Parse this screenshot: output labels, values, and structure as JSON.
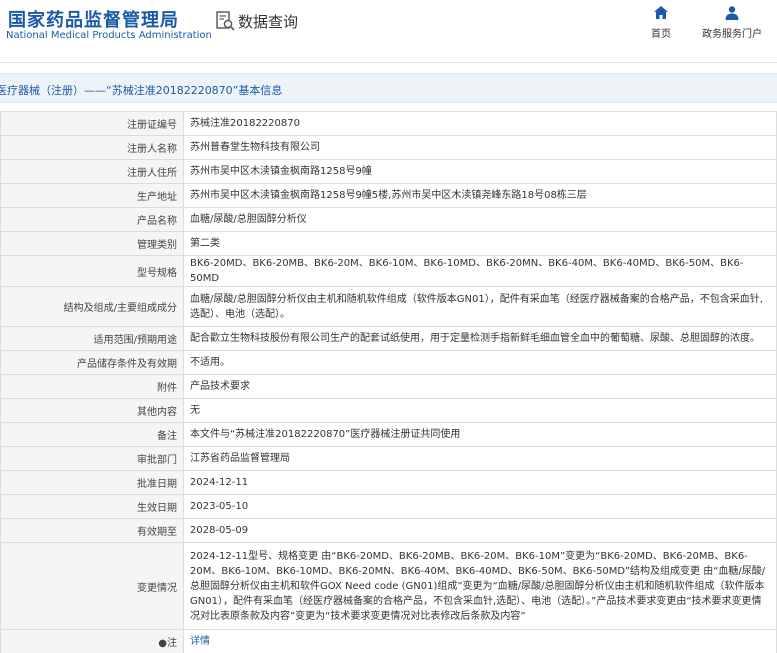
{
  "header": {
    "logo_cn": "国家药品监督管理局",
    "logo_en": "National Medical Products Administration",
    "query_label": "数据查询",
    "nav": {
      "home": "首页",
      "portal": "政务服务门户"
    }
  },
  "page": {
    "breadcrumb": "医疗器械（注册）——“苏械注准20182220870”基本信息"
  },
  "colors": {
    "brand": "#1c5aa8",
    "label_bg": "#f5f5f5",
    "title_bg": "#eef3f8",
    "border": "#dcdcdc"
  },
  "rows": [
    {
      "label": "注册证编号",
      "value": "苏械注准20182220870"
    },
    {
      "label": "注册人名称",
      "value": "苏州普春堂生物科技有限公司"
    },
    {
      "label": "注册人住所",
      "value": "苏州市吴中区木渎镇金枫南路1258号9幢"
    },
    {
      "label": "生产地址",
      "value": "苏州市吴中区木渎镇金枫南路1258号9幢5楼,苏州市吴中区木渎镇尧峰东路18号08栋三层"
    },
    {
      "label": "产品名称",
      "value": "血糖/尿酸/总胆固醇分析仪"
    },
    {
      "label": "管理类别",
      "value": "第二类"
    },
    {
      "label": "型号规格",
      "value": "BK6-20MD、BK6-20MB、BK6-20M、BK6-10M、BK6-10MD、BK6-20MN、BK6-40M、BK6-40MD、BK6-50M、BK6-50MD"
    },
    {
      "label": "结构及组成/主要组成成分",
      "value": "血糖/尿酸/总胆固醇分析仪由主机和随机软件组成（软件版本GN01），配件有采血笔（经医疗器械备案的合格产品，不包含采血针,选配）、电池（选配）。"
    },
    {
      "label": "适用范围/预期用途",
      "value": "配合歡立生物科技股份有限公司生产的配套试纸使用，用于定量检测手指新鲜毛细血管全血中的葡萄糖、尿酸、总胆固醇的浓度。"
    },
    {
      "label": "产品储存条件及有效期",
      "value": "不适用。"
    },
    {
      "label": "附件",
      "value": "产品技术要求"
    },
    {
      "label": "其他内容",
      "value": "无"
    },
    {
      "label": "备注",
      "value": "本文件与“苏械注准20182220870”医疗器械注册证共同使用"
    },
    {
      "label": "审批部门",
      "value": "江苏省药品监督管理局"
    },
    {
      "label": "批准日期",
      "value": "2024-12-11"
    },
    {
      "label": "生效日期",
      "value": "2023-05-10"
    },
    {
      "label": "有效期至",
      "value": "2028-05-09"
    },
    {
      "label": "变更情况",
      "value": "2024-12-11型号、规格变更 由“BK6-20MD、BK6-20MB、BK6-20M、BK6-10M”变更为“BK6-20MD、BK6-20MB、BK6-20M、BK6-10M、BK6-10MD、BK6-20MN、BK6-40M、BK6-40MD、BK6-50M、BK6-50MD”结构及组成变更 由“血糖/尿酸/总胆固醇分析仪由主机和软件GOX Need code (GN01)组成”变更为“血糖/尿酸/总胆固醇分析仪由主机和随机软件组成（软件版本GN01），配件有采血笔（经医疗器械备案的合格产品，不包含采血针,选配）、电池（选配）。”产品技术要求变更由“技术要求变更情况对比表原条款及内容”变更为“技术要求变更情况对比表修改后条款及内容”"
    },
    {
      "label": "●注",
      "value": "详情"
    }
  ]
}
